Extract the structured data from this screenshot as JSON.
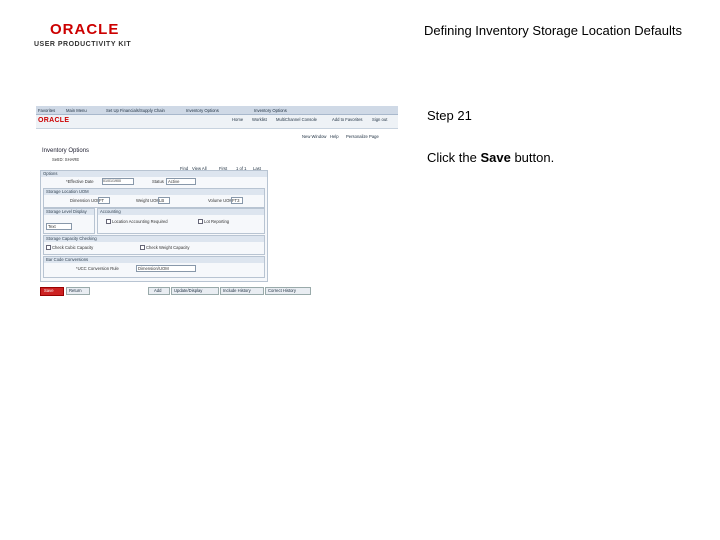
{
  "header": {
    "logo_brand": "ORACLE",
    "logo_sub": "USER PRODUCTIVITY KIT",
    "slide_title": "Defining Inventory Storage Location Defaults"
  },
  "step": {
    "label": "Step 21",
    "instruction_pre": "Click the ",
    "instruction_emph": "Save",
    "instruction_post": " button."
  },
  "screenshot": {
    "nav": [
      "Favorites",
      "Main Menu",
      "Set Up Financials/Supply Chain",
      "Inventory Options",
      "Inventory Options"
    ],
    "brand": "ORACLE",
    "header_links": [
      "Home",
      "Worklist",
      "MultiChannel Console",
      "Add to Favorites",
      "Sign out"
    ],
    "util_links": [
      "New Window",
      "Help",
      "Personalize Page"
    ],
    "page_title": "Inventory Options",
    "setid_label": "SetID: SHARE",
    "nav_ctrl": [
      "Find",
      "View All",
      "First",
      "1 of 1",
      "Last"
    ],
    "options_label": "Options",
    "eff_date_label": "*Effective Date",
    "eff_date_value": "01/01/1900",
    "status_label": "Status",
    "status_value": "Active",
    "storage_uom_label": "Storage Location UOM",
    "dimension_label": "Dimension UOM",
    "dimension_value": "FT",
    "weight_label": "Weight UOM",
    "weight_value": "LB",
    "volume_label": "Volume UOM",
    "volume_value": "FT3",
    "level_label": "Storage Level Display",
    "level_value": "Text",
    "accounting_label": "Accounting",
    "loc_acct_label": "Location Accounting Required",
    "lot_label": "Lot Reporting",
    "capacity_label": "Storage Capacity Checking",
    "cube_label": "Check Cubic Capacity",
    "weight_chk_label": "Check Weight Capacity",
    "bar_label": "Bar Code Conversions",
    "bar_field_label": "*UCC Conversion Rule",
    "bar_value": "Dimension/UOM",
    "save_label": "Save",
    "return_label": "Return",
    "bottom_buttons": [
      "Add",
      "Update/Display",
      "Include History",
      "Correct History"
    ]
  }
}
